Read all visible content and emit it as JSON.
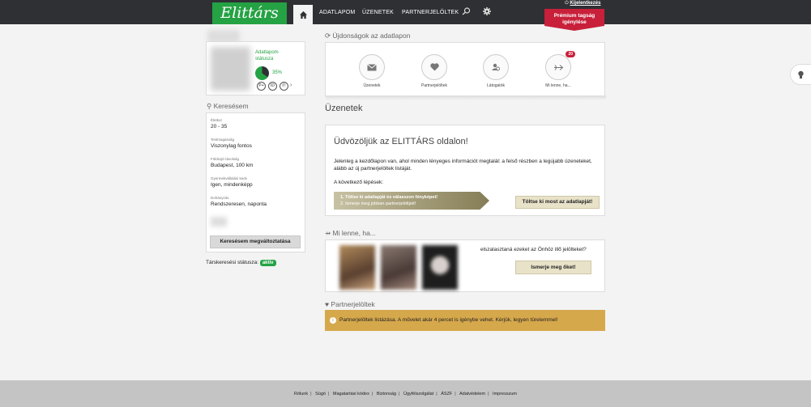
{
  "header": {
    "logo_text": "Elittárs",
    "nav": [
      "ADATLAPOM",
      "ÜZENETEK",
      "PARTNERJELÖLTEK"
    ],
    "logout_label": "Kijelentkezés",
    "premium_line1": "Prémium tagság",
    "premium_line2": "igénylése"
  },
  "profile": {
    "status_label": "Adatlapom státusza",
    "completion": "35%",
    "completion_value": 0.35,
    "badges": [
      "P+",
      "ID",
      "Ⓟ"
    ]
  },
  "search": {
    "title": "Keresésem",
    "criteria": [
      {
        "label": "Életkor",
        "value": "20 - 35"
      },
      {
        "label": "Testmagasság",
        "value": "Viszonylag fontos"
      },
      {
        "label": "Földrajzi távolság",
        "value": "Budapest, 100 km"
      },
      {
        "label": "Gyermekvállalási kedv",
        "value": "Igen, mindenképp"
      },
      {
        "label": "Dohányzás",
        "value": "Rendszeresen, naponta"
      }
    ],
    "change_button": "Keresésem megváltoztatása",
    "status_label": "Társkeresési státusza:",
    "status_value": "aktív"
  },
  "news": {
    "title": "Újdonságok az adatlapon",
    "items": [
      {
        "label": "Üzenetek",
        "icon": "envelope-icon"
      },
      {
        "label": "Partnerjelöltek",
        "icon": "heart-icon"
      },
      {
        "label": "Látogatók",
        "icon": "visitor-icon"
      },
      {
        "label": "Mi lenne, ha...",
        "icon": "arrow-icon",
        "badge": "20"
      }
    ]
  },
  "messages": {
    "title": "Üzenetek",
    "welcome_title": "Üdvözöljük az ELITTÁRS oldalon!",
    "welcome_text": "Jelenleg a kezdőlapon van, ahol minden lényeges információt megtalál: a felső részben a legújabb üzeneteket, alább az új partnerjelöltek listáját.",
    "next_steps": "A következő lépések:",
    "step1": "1. Töltse ki adatlapját és válasszon fényképet!",
    "step2": "2. Ismerje meg jobban partnerjelöltjeit!",
    "fill_button": "Töltse ki most az adatlapját!"
  },
  "whatif": {
    "title": "Mi lenne, ha...",
    "question": "elszalasztaná ezeket az Önhöz illő jelölteket?",
    "meet_button": "Ismerje meg őket!"
  },
  "partners": {
    "title": "Partnerjelöltek",
    "loading_text": "Partnerjelöltek listázása. A művelet akár 4 percet is igénybe vehet. Kérjük, legyen türelemmel!"
  },
  "footer": {
    "links": [
      "Rólunk",
      "Súgó",
      "Magatartási kódex",
      "Biztonság",
      "Ügyfélszolgálat",
      "ÁSZF",
      "Adatvédelem",
      "Impresszum"
    ]
  },
  "colors": {
    "brand_green": "#25a244",
    "premium_red": "#c8203a",
    "notice_gold": "#d6a84c"
  }
}
